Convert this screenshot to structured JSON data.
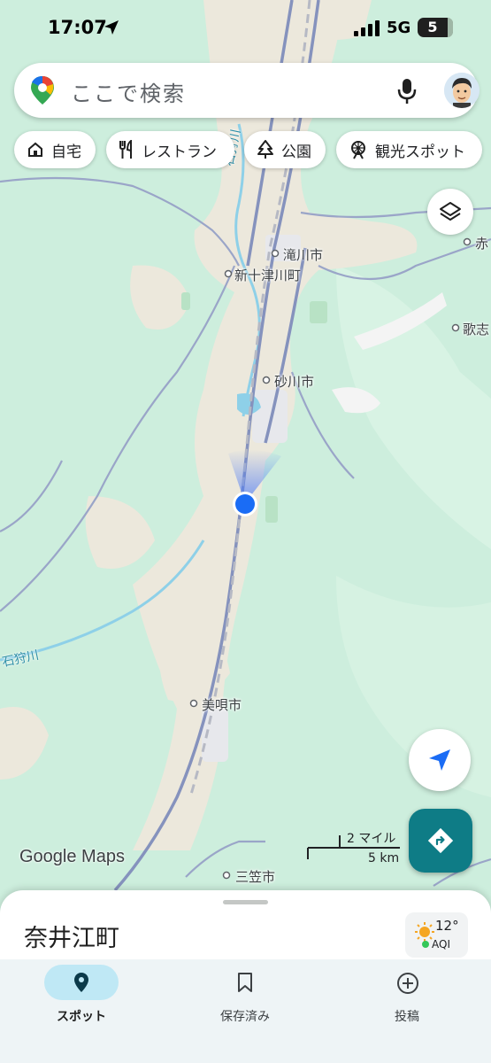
{
  "status_bar": {
    "time": "17:07",
    "network": "5G",
    "battery": "5"
  },
  "search": {
    "placeholder": "ここで検索"
  },
  "chips": [
    {
      "label": "自宅",
      "icon": "home-icon"
    },
    {
      "label": "レストラン",
      "icon": "restaurant-icon"
    },
    {
      "label": "公園",
      "icon": "park-icon"
    },
    {
      "label": "観光スポット",
      "icon": "attraction-icon"
    }
  ],
  "map_labels": {
    "takikawa": "滝川市",
    "shintotsukawa": "新十津川町",
    "sunagawa": "砂川市",
    "bibai": "美唄市",
    "mikasa": "三笠市",
    "utashinai": "歌志",
    "akabira": "赤"
  },
  "rivers": {
    "ishikari_north": "石狩川",
    "ishikari_south": "石狩川"
  },
  "watermark": "Google Maps",
  "scale": {
    "imperial": "2 マイル",
    "metric": "5 km"
  },
  "sheet": {
    "place_name": "奈井江町"
  },
  "weather": {
    "temperature": "12°",
    "aqi_label": "AQI"
  },
  "nav": [
    {
      "label": "スポット",
      "icon": "explore-pin-icon",
      "active": true
    },
    {
      "label": "保存済み",
      "icon": "bookmark-icon",
      "active": false
    },
    {
      "label": "投稿",
      "icon": "add-circle-icon",
      "active": false
    }
  ],
  "colors": {
    "land": "#cdeedd",
    "urban": "#ece8dc",
    "road": "#9aa5c8",
    "water": "#8ed0e8",
    "location": "#1a6cf5",
    "accent": "#0e7c86"
  }
}
